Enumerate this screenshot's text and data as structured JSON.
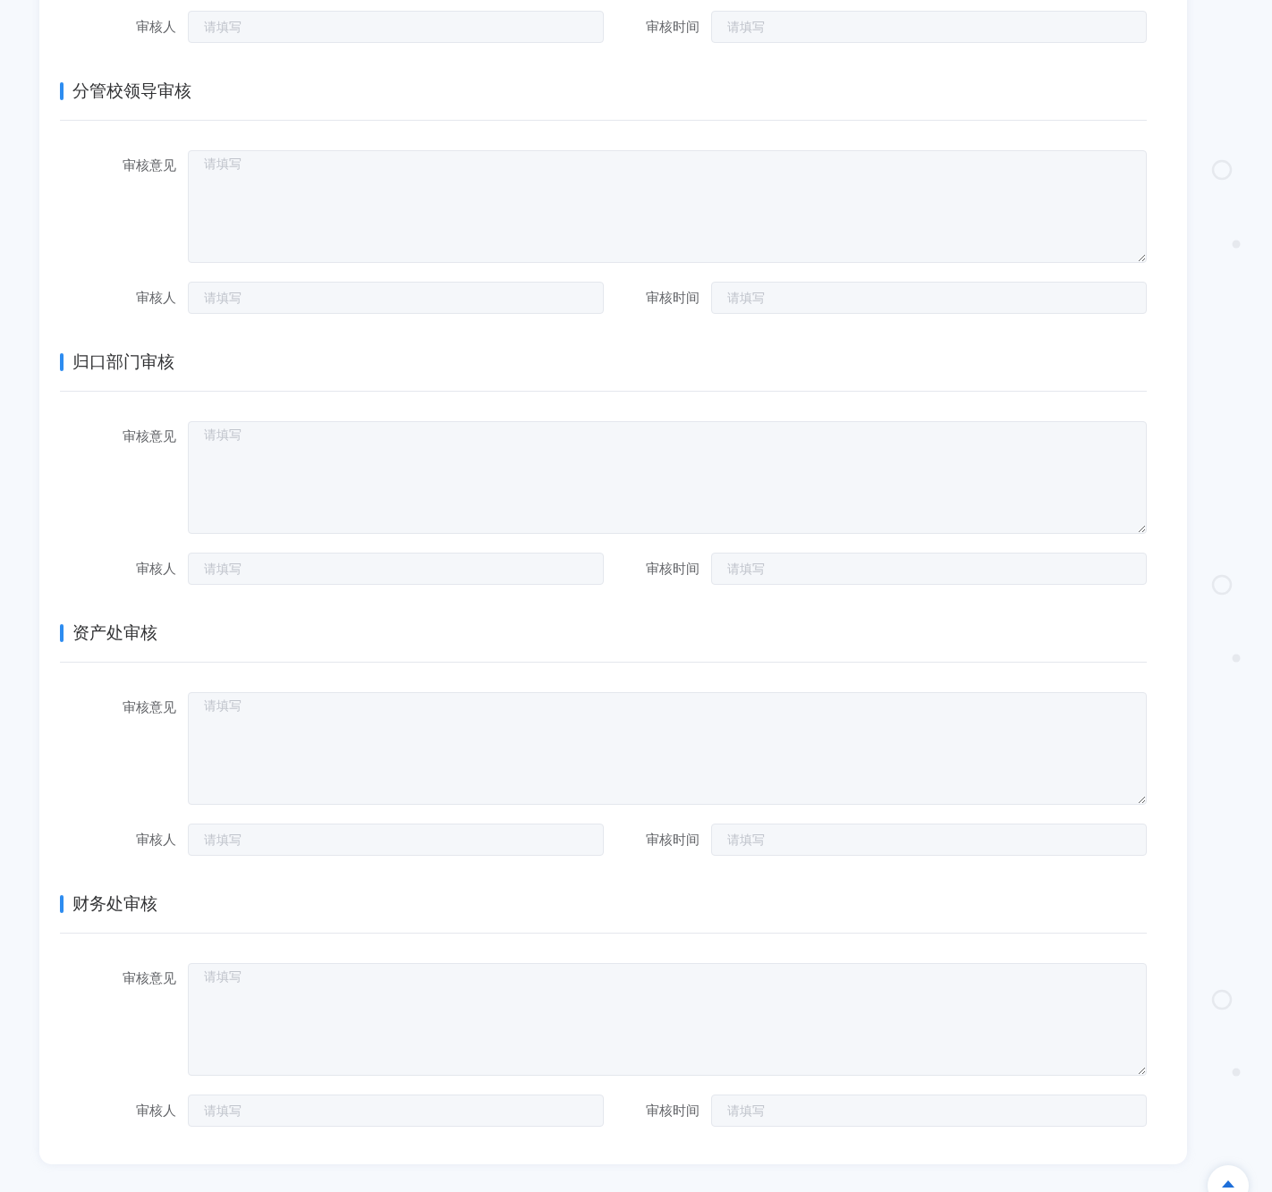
{
  "top_row": {
    "reviewer": {
      "label": "审核人",
      "placeholder": "请填写"
    },
    "time": {
      "label": "审核时间",
      "placeholder": "请填写"
    }
  },
  "sections": [
    {
      "title": "分管校领导审核",
      "opinion": {
        "label": "审核意见",
        "placeholder": "请填写"
      },
      "reviewer": {
        "label": "审核人",
        "placeholder": "请填写"
      },
      "time": {
        "label": "审核时间",
        "placeholder": "请填写"
      }
    },
    {
      "title": "归口部门审核",
      "opinion": {
        "label": "审核意见",
        "placeholder": "请填写"
      },
      "reviewer": {
        "label": "审核人",
        "placeholder": "请填写"
      },
      "time": {
        "label": "审核时间",
        "placeholder": "请填写"
      }
    },
    {
      "title": "资产处审核",
      "opinion": {
        "label": "审核意见",
        "placeholder": "请填写"
      },
      "reviewer": {
        "label": "审核人",
        "placeholder": "请填写"
      },
      "time": {
        "label": "审核时间",
        "placeholder": "请填写"
      }
    },
    {
      "title": "财务处审核",
      "opinion": {
        "label": "审核意见",
        "placeholder": "请填写"
      },
      "reviewer": {
        "label": "审核人",
        "placeholder": "请填写"
      },
      "time": {
        "label": "审核时间",
        "placeholder": "请填写"
      }
    }
  ]
}
